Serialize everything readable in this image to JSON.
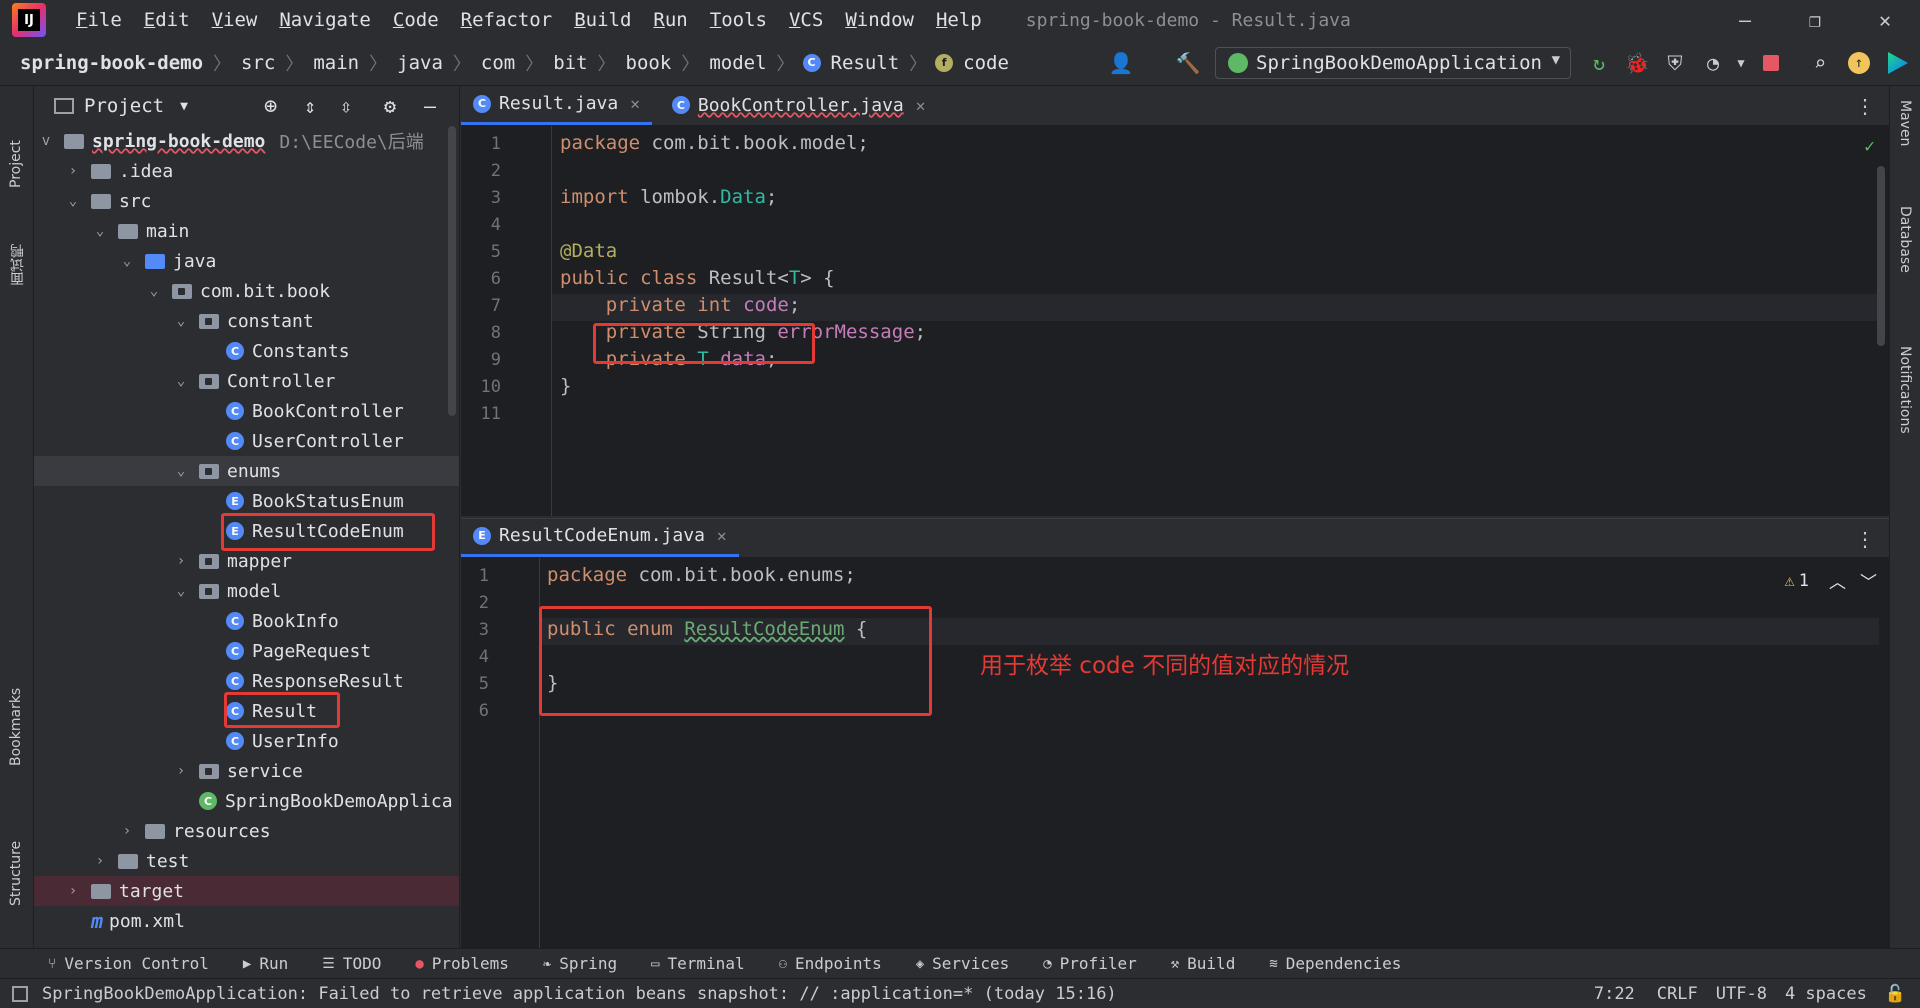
{
  "window": {
    "title": "spring-book-demo - Result.java",
    "menu": [
      "File",
      "Edit",
      "View",
      "Navigate",
      "Code",
      "Refactor",
      "Build",
      "Run",
      "Tools",
      "VCS",
      "Window",
      "Help"
    ]
  },
  "breadcrumb": [
    "spring-book-demo",
    "src",
    "main",
    "java",
    "com",
    "bit",
    "book",
    "model",
    "Result",
    "code"
  ],
  "run_config": "SpringBookDemoApplication",
  "project_panel": {
    "title": "Project",
    "root": "spring-book-demo",
    "root_path": "D:\\EECode\\后端",
    "tree": [
      {
        "label": ".idea",
        "kind": "folder"
      },
      {
        "label": "src",
        "kind": "folder"
      },
      {
        "label": "main",
        "kind": "folder"
      },
      {
        "label": "java",
        "kind": "folder-blue"
      },
      {
        "label": "com.bit.book",
        "kind": "package"
      },
      {
        "label": "constant",
        "kind": "package"
      },
      {
        "label": "Constants",
        "kind": "class"
      },
      {
        "label": "Controller",
        "kind": "package"
      },
      {
        "label": "BookController",
        "kind": "class"
      },
      {
        "label": "UserController",
        "kind": "class"
      },
      {
        "label": "enums",
        "kind": "package"
      },
      {
        "label": "BookStatusEnum",
        "kind": "enum"
      },
      {
        "label": "ResultCodeEnum",
        "kind": "enum"
      },
      {
        "label": "mapper",
        "kind": "package"
      },
      {
        "label": "model",
        "kind": "package"
      },
      {
        "label": "BookInfo",
        "kind": "class"
      },
      {
        "label": "PageRequest",
        "kind": "class"
      },
      {
        "label": "ResponseResult",
        "kind": "class"
      },
      {
        "label": "Result",
        "kind": "class"
      },
      {
        "label": "UserInfo",
        "kind": "class"
      },
      {
        "label": "service",
        "kind": "package"
      },
      {
        "label": "SpringBookDemoApplica",
        "kind": "app"
      },
      {
        "label": "resources",
        "kind": "folder"
      },
      {
        "label": "test",
        "kind": "folder"
      },
      {
        "label": "target",
        "kind": "folder"
      },
      {
        "label": "pom.xml",
        "kind": "maven"
      }
    ]
  },
  "editor_top": {
    "tabs": [
      "Result.java",
      "BookController.java"
    ],
    "lines": [
      "package com.bit.book.model;",
      "",
      "import lombok.Data;",
      "",
      "@Data",
      "public class Result<T> {",
      "    private int code;",
      "    private String errorMessage;",
      "    private T data;",
      "}",
      ""
    ]
  },
  "editor_bottom": {
    "tabs": [
      "ResultCodeEnum.java"
    ],
    "warnings": "1",
    "lines": [
      "package com.bit.book.enums;",
      "",
      "public enum ResultCodeEnum {",
      "",
      "}",
      ""
    ]
  },
  "annotation_note": "用于枚举 code 不同的值对应的情况",
  "left_stripe": [
    "Project",
    "面试鸭",
    "Bookmarks",
    "Structure"
  ],
  "right_stripe": [
    "Maven",
    "Database",
    "Notifications"
  ],
  "tool_windows": [
    "Version Control",
    "Run",
    "TODO",
    "Problems",
    "Spring",
    "Terminal",
    "Endpoints",
    "Services",
    "Profiler",
    "Build",
    "Dependencies"
  ],
  "status": {
    "message": "SpringBookDemoApplication: Failed to retrieve application beans snapshot: // :application=* (today 15:16)",
    "position": "7:22",
    "line_sep": "CRLF",
    "encoding": "UTF-8",
    "indent": "4 spaces"
  }
}
